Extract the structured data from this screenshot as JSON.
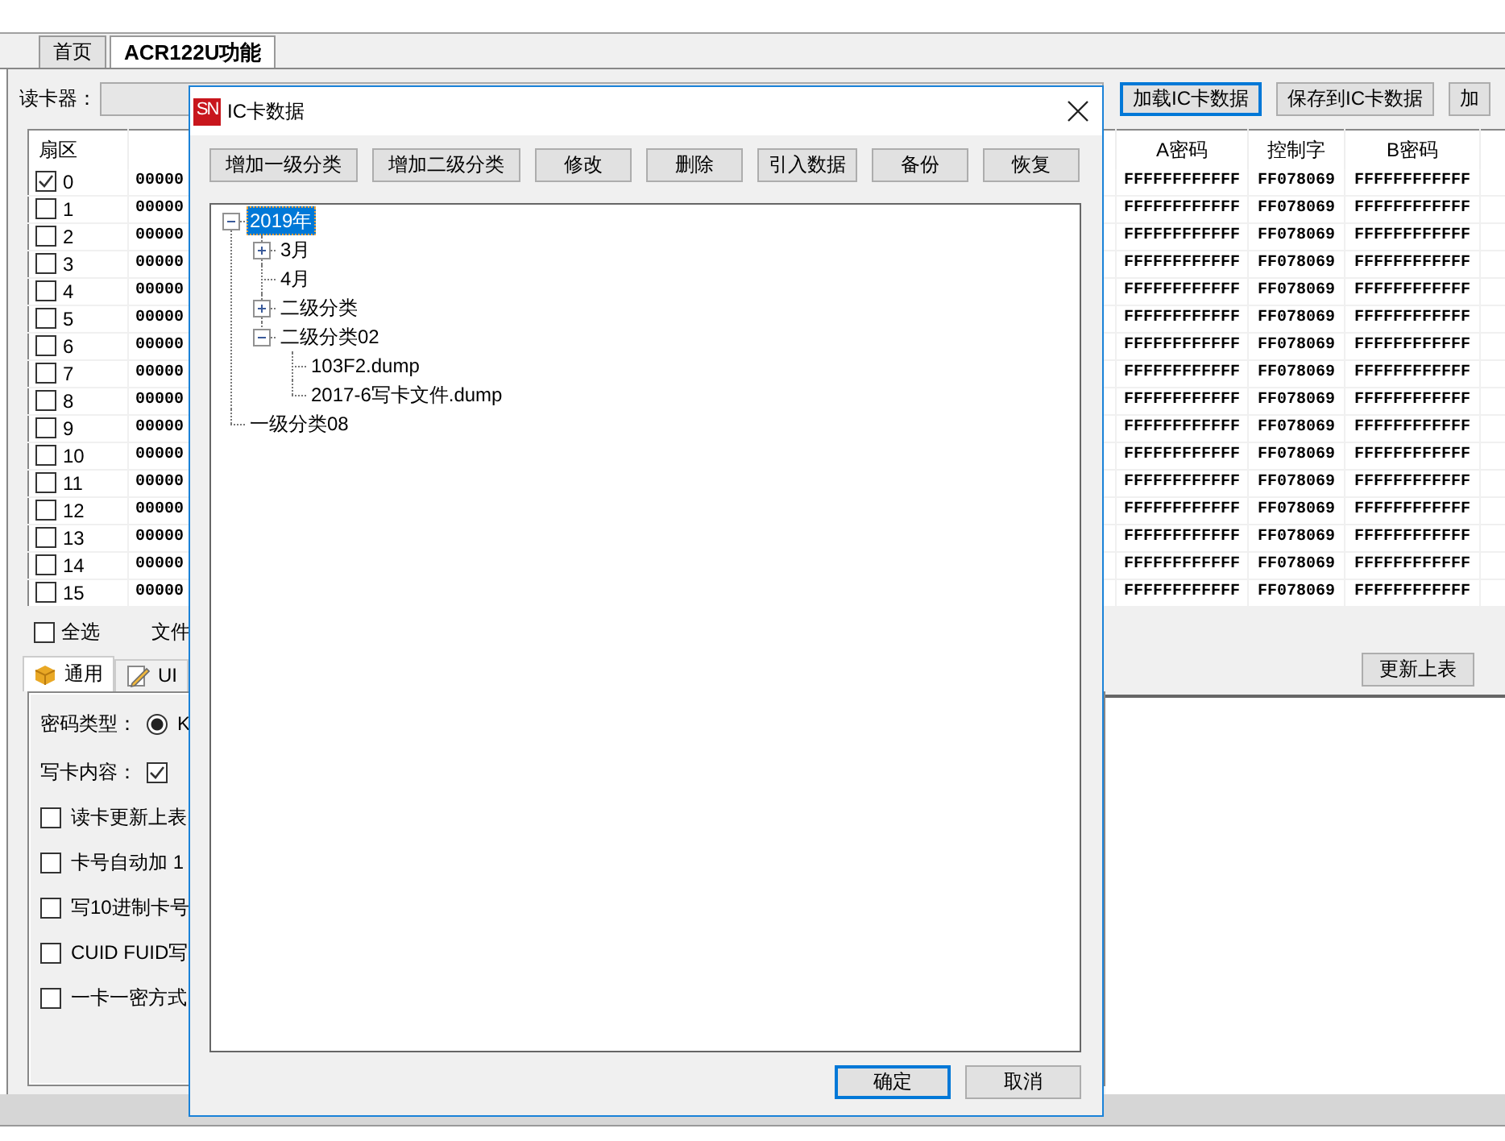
{
  "app_tabs": [
    {
      "label": "首页",
      "selected": false
    },
    {
      "label": "ACR122U功能",
      "selected": true
    }
  ],
  "reader": {
    "label": "读卡器："
  },
  "top_buttons": [
    {
      "label": "加载IC卡数据",
      "focused": true
    },
    {
      "label": "保存到IC卡数据",
      "focused": false
    },
    {
      "label": "加",
      "focused": false
    }
  ],
  "sector_table": {
    "columns": {
      "sector": "扇区",
      "a_key": "A密码",
      "access": "控制字",
      "b_key": "B密码"
    },
    "rows": [
      {
        "sector": "0",
        "checked": true,
        "data": "00000",
        "a_key": "FFFFFFFFFFFF",
        "access": "FF078069",
        "b_key": "FFFFFFFFFFFF"
      },
      {
        "sector": "1",
        "checked": false,
        "data": "00000",
        "a_key": "FFFFFFFFFFFF",
        "access": "FF078069",
        "b_key": "FFFFFFFFFFFF"
      },
      {
        "sector": "2",
        "checked": false,
        "data": "00000",
        "a_key": "FFFFFFFFFFFF",
        "access": "FF078069",
        "b_key": "FFFFFFFFFFFF"
      },
      {
        "sector": "3",
        "checked": false,
        "data": "00000",
        "a_key": "FFFFFFFFFFFF",
        "access": "FF078069",
        "b_key": "FFFFFFFFFFFF"
      },
      {
        "sector": "4",
        "checked": false,
        "data": "00000",
        "a_key": "FFFFFFFFFFFF",
        "access": "FF078069",
        "b_key": "FFFFFFFFFFFF"
      },
      {
        "sector": "5",
        "checked": false,
        "data": "00000",
        "a_key": "FFFFFFFFFFFF",
        "access": "FF078069",
        "b_key": "FFFFFFFFFFFF"
      },
      {
        "sector": "6",
        "checked": false,
        "data": "00000",
        "a_key": "FFFFFFFFFFFF",
        "access": "FF078069",
        "b_key": "FFFFFFFFFFFF"
      },
      {
        "sector": "7",
        "checked": false,
        "data": "00000",
        "a_key": "FFFFFFFFFFFF",
        "access": "FF078069",
        "b_key": "FFFFFFFFFFFF"
      },
      {
        "sector": "8",
        "checked": false,
        "data": "00000",
        "a_key": "FFFFFFFFFFFF",
        "access": "FF078069",
        "b_key": "FFFFFFFFFFFF"
      },
      {
        "sector": "9",
        "checked": false,
        "data": "00000",
        "a_key": "FFFFFFFFFFFF",
        "access": "FF078069",
        "b_key": "FFFFFFFFFFFF"
      },
      {
        "sector": "10",
        "checked": false,
        "data": "00000",
        "a_key": "FFFFFFFFFFFF",
        "access": "FF078069",
        "b_key": "FFFFFFFFFFFF"
      },
      {
        "sector": "11",
        "checked": false,
        "data": "00000",
        "a_key": "FFFFFFFFFFFF",
        "access": "FF078069",
        "b_key": "FFFFFFFFFFFF"
      },
      {
        "sector": "12",
        "checked": false,
        "data": "00000",
        "a_key": "FFFFFFFFFFFF",
        "access": "FF078069",
        "b_key": "FFFFFFFFFFFF"
      },
      {
        "sector": "13",
        "checked": false,
        "data": "00000",
        "a_key": "FFFFFFFFFFFF",
        "access": "FF078069",
        "b_key": "FFFFFFFFFFFF"
      },
      {
        "sector": "14",
        "checked": false,
        "data": "00000",
        "a_key": "FFFFFFFFFFFF",
        "access": "FF078069",
        "b_key": "FFFFFFFFFFFF"
      },
      {
        "sector": "15",
        "checked": false,
        "data": "00000",
        "a_key": "FFFFFFFFFFFF",
        "access": "FF078069",
        "b_key": "FFFFFFFFFFFF"
      }
    ]
  },
  "select_all": {
    "label": "全选",
    "checked": false
  },
  "file_label": "文件",
  "option_tabs": [
    {
      "label": "通用",
      "selected": true
    },
    {
      "label": "UI",
      "selected": false
    }
  ],
  "options": [
    {
      "kind": "radio-field",
      "label": "密码类型：",
      "value": "K",
      "checked": true
    },
    {
      "kind": "checkbox-field",
      "label": "写卡内容：",
      "checked": true
    },
    {
      "kind": "checkbox",
      "label": "读卡更新上表",
      "checked": false
    },
    {
      "kind": "checkbox",
      "label": "卡号自动加 1",
      "checked": false
    },
    {
      "kind": "checkbox",
      "label": "写10进制卡号",
      "checked": false
    },
    {
      "kind": "checkbox",
      "label": "CUID FUID写",
      "checked": false
    },
    {
      "kind": "checkbox",
      "label": "一卡一密方式",
      "checked": false
    }
  ],
  "update_button": "更新上表",
  "dialog": {
    "logo": "SN",
    "title": "IC卡数据",
    "toolbar": [
      "增加一级分类",
      "增加二级分类",
      "修改",
      "删除",
      "引入数据",
      "备份",
      "恢复"
    ],
    "tree": [
      {
        "label": "2019年",
        "kind": "branch",
        "expanded": true,
        "selected": true,
        "children": [
          {
            "label": "3月",
            "kind": "branch",
            "expanded": false,
            "selected": false
          },
          {
            "label": "4月",
            "kind": "leaf",
            "selected": false
          },
          {
            "label": "二级分类",
            "kind": "branch",
            "expanded": false,
            "selected": false
          },
          {
            "label": "二级分类02",
            "kind": "branch",
            "expanded": true,
            "selected": false,
            "children": [
              {
                "label": "103F2.dump",
                "kind": "leaf",
                "selected": false
              },
              {
                "label": "2017-6写卡文件.dump",
                "kind": "leaf",
                "selected": false
              }
            ]
          }
        ]
      },
      {
        "label": "一级分类08",
        "kind": "leaf",
        "selected": false
      }
    ],
    "buttons": [
      {
        "label": "确定",
        "focused": true
      },
      {
        "label": "取消",
        "focused": false
      }
    ]
  }
}
